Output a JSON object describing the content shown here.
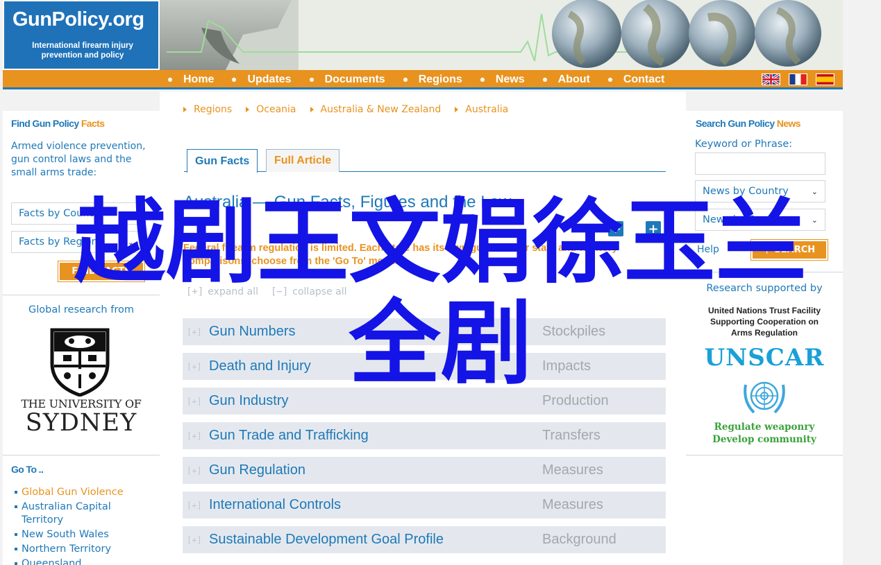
{
  "logo": {
    "title": "GunPolicy.org",
    "subtitle_line1": "International firearm injury",
    "subtitle_line2": "prevention and policy"
  },
  "nav": [
    "Home",
    "Updates",
    "Documents",
    "Regions",
    "News",
    "About",
    "Contact"
  ],
  "flags": [
    "uk-flag",
    "france-flag",
    "spain-flag"
  ],
  "left": {
    "facts_heading_main": "Find Gun Policy",
    "facts_heading_accent": "Facts",
    "facts_desc": "Armed violence prevention, gun control laws and the small arms trade:",
    "select_country": "Facts by Country",
    "select_region": "Facts by Region",
    "find_button": "FIND FACTS",
    "global_research": "Global research from",
    "uni_line1": "THE UNIVERSITY OF",
    "uni_line2": "SYDNEY",
    "goto_heading": "Go To ..",
    "goto_items": [
      "Global Gun Violence",
      "Australian Capital Territory",
      "New South Wales",
      "Northern Territory",
      "Queensland"
    ]
  },
  "breadcrumb": [
    "Regions",
    "Oceania",
    "Australia & New Zealand",
    "Australia"
  ],
  "tabs": {
    "active": "Gun Facts",
    "inactive": "Full Article"
  },
  "title": "Australia — Gun Facts, Figures and the Law",
  "intro": "Federal firearm regulation is limited. Each state has its own gun law. For state and territory comparisons, choose from the 'Go To' menu.",
  "expand": {
    "expand_all": "expand all",
    "collapse_all": "collapse all",
    "expand_glyph": "[+]",
    "collapse_glyph": "[−]"
  },
  "sections": [
    {
      "title": "Gun Numbers",
      "category": "Stockpiles"
    },
    {
      "title": "Death and Injury",
      "category": "Impacts"
    },
    {
      "title": "Gun Industry",
      "category": "Production"
    },
    {
      "title": "Gun Trade and Trafficking",
      "category": "Transfers"
    },
    {
      "title": "Gun Regulation",
      "category": "Measures"
    },
    {
      "title": "International Controls",
      "category": "Measures"
    },
    {
      "title": "Sustainable Development Goal Profile",
      "category": "Background"
    }
  ],
  "right": {
    "news_heading_main": "Search Gun Policy",
    "news_heading_accent": "News",
    "keyword_label": "Keyword or Phrase:",
    "keyword_value": "",
    "select_country": "News by Country",
    "select_region": "News by Region",
    "help_link": "Help",
    "search_button": "SEARCH",
    "research_supported": "Research supported by",
    "un_line1": "United Nations Trust Facility",
    "un_line2": "Supporting Cooperation on",
    "un_line3": "Arms Regulation",
    "unscar": "UNSCAR",
    "unscar_tag1": "Regulate weaponry",
    "unscar_tag2": "Develop community"
  },
  "overlay": {
    "line1": "越剧王文娟徐玉兰",
    "line2": "全剧"
  },
  "colors": {
    "blue": "#1e79b8",
    "orange": "#e8931f",
    "overlay": "#1414e6",
    "row_bg": "#e4e8ee"
  }
}
